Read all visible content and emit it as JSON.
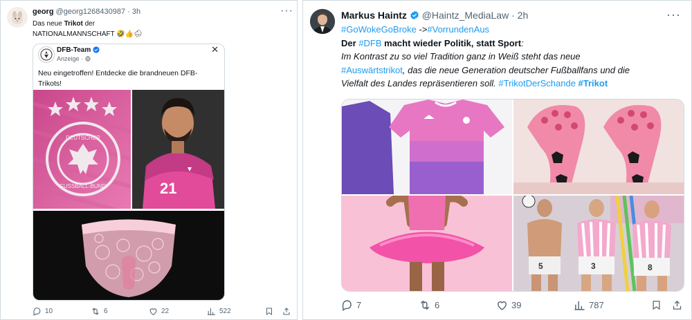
{
  "left_tweet": {
    "author_name": "georg",
    "author_handle": "@georg1268430987",
    "time": "3h",
    "text_part1": "Das neue ",
    "text_bold": "Trikot",
    "text_part2": " der",
    "text_line2": "NATIONALMANNSCHAFT",
    "emojis": "🤣👍🌧",
    "card": {
      "name": "DFB-Team",
      "sponsored": "Anzeige ·",
      "text": "Neu eingetroffen! Entdecke die brandneuen DFB-Trikots!",
      "crest_text_top": "DEUTSCHER",
      "crest_text_bottom": "FUSSBALL-BUND",
      "jersey_number": "21"
    },
    "actions": {
      "replies": "10",
      "reposts": "6",
      "likes": "22",
      "views": "522"
    }
  },
  "right_tweet": {
    "author_name": "Markus Haintz",
    "author_handle": "@Haintz_MediaLaw",
    "time": "2h",
    "hashtag_1": "#GoWokeGoBroke",
    "arrow": " ->",
    "hashtag_2": "#VorrundenAus",
    "line2_a": "Der ",
    "line2_tag": "#DFB",
    "line2_b": " macht wieder Politik, statt Sport",
    "line2_c": ":",
    "line3": "Im Kontrast zu so viel Tradition ganz in Weiß steht das neue",
    "line4_tag": "#Auswärtstrikot",
    "line4_b": ", das die neue Generation deutscher Fußballfans und die",
    "line5_a": "Vielfalt des Landes repräsentieren soll. ",
    "line5_tag1": "#TrikotDerSchande",
    "line5_tag2": "#Trikot",
    "images": {
      "img4_numbers": [
        "5",
        "3",
        "8"
      ]
    },
    "actions": {
      "replies": "7",
      "reposts": "6",
      "likes": "39",
      "views": "787"
    }
  },
  "colors": {
    "link": "#1d9bf0",
    "verified": "#1d9bf0",
    "muted": "#536471",
    "border": "#cfd9de"
  }
}
